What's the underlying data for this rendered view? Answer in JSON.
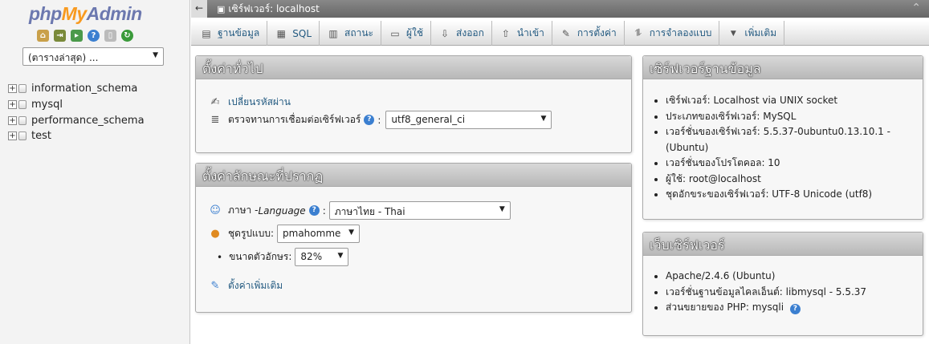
{
  "nav": {
    "logo": {
      "part1": "php",
      "part2": "My",
      "part3": "Admin"
    },
    "icons": [
      "home-icon",
      "exit-icon",
      "sql-query-icon",
      "docs-icon",
      "page-icon",
      "reload-icon"
    ],
    "db_select": "(ตารางล่าสุด) ...",
    "databases": [
      "information_schema",
      "mysql",
      "performance_schema",
      "test"
    ]
  },
  "topbar": {
    "back": "←",
    "title": "เซิร์ฟเวอร์: localhost",
    "collapse": "⌃"
  },
  "menu": [
    {
      "label": "ฐานข้อมูล",
      "icon": "database-icon",
      "glyph": "▤"
    },
    {
      "label": "SQL",
      "icon": "sql-icon",
      "glyph": "▦"
    },
    {
      "label": "สถานะ",
      "icon": "status-icon",
      "glyph": "▥"
    },
    {
      "label": "ผู้ใช้",
      "icon": "users-icon",
      "glyph": "▭"
    },
    {
      "label": "ส่งออก",
      "icon": "export-icon",
      "glyph": "⇩"
    },
    {
      "label": "นำเข้า",
      "icon": "import-icon",
      "glyph": "⇧"
    },
    {
      "label": "การตั้งค่า",
      "icon": "settings-wrench-icon",
      "glyph": "✎"
    },
    {
      "label": "การจำลองแบบ",
      "icon": "replication-icon",
      "glyph": "⥮"
    },
    {
      "label": "เพิ่มเติม",
      "icon": "more-chevron-icon",
      "glyph": "▼"
    }
  ],
  "general": {
    "title": "ตั้งค่าทั่วไป",
    "change_password": "เปลี่ยนรหัสผ่าน",
    "collation_label": "ตรวจทานการเชื่อมต่อเซิร์ฟเวอร์",
    "collation_value": "utf8_general_ci"
  },
  "appearance": {
    "title": "ตั้งค่าลักษณะที่ปรากฏ",
    "language_label": "ภาษา - ",
    "language_en": "Language",
    "language_value": "ภาษาไทย - Thai",
    "theme_label": "ชุดรูปแบบ:",
    "theme_value": "pmahomme",
    "font_label": "ขนาดตัวอักษร:",
    "font_value": "82%",
    "more_settings": "ตั้งค่าเพิ่มเติม"
  },
  "db_server": {
    "title": "เซิร์ฟเวอร์ฐานข้อมูล",
    "items": [
      "เซิร์ฟเวอร์: Localhost via UNIX socket",
      "ประเภทของเซิร์ฟเวอร์: MySQL",
      "เวอร์ชั่นของเซิร์ฟเวอร์: 5.5.37-0ubuntu0.13.10.1 - (Ubuntu)",
      "เวอร์ชั่นของโปรโตคอล: 10",
      "ผู้ใช้: root@localhost",
      "ชุดอักขระของเซิร์ฟเวอร์: UTF-8 Unicode (utf8)"
    ]
  },
  "web_server": {
    "title": "เว็บเซิร์ฟเวอร์",
    "items": [
      "Apache/2.4.6 (Ubuntu)",
      "เวอร์ชั่นฐานข้อมูลไคลเอ็นต์: libmysql - 5.5.37",
      "ส่วนขยายของ PHP: mysqli"
    ]
  }
}
